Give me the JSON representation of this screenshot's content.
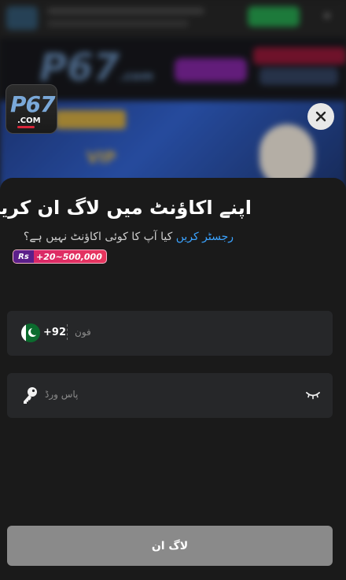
{
  "background": {
    "brand_logo": "P67",
    "brand_suffix": ".com"
  },
  "app_icon": {
    "logo_text": "P67",
    "domain_text": ".COM"
  },
  "modal": {
    "title": "اپنے اکاؤنٹ میں لاگ ان کریں",
    "subtitle_text": "کیا آپ کا کوئی اکاؤنٹ نہیں ہے؟",
    "register_link": "رجسٹر کریں",
    "bonus": {
      "currency": "Rs",
      "amount": "+20~500,000"
    },
    "phone": {
      "country_code": "+92",
      "placeholder": "فون",
      "flag_icon": "pakistan-flag-icon"
    },
    "password": {
      "placeholder": "پاس ورڈ",
      "key_icon": "key-icon",
      "visibility_icon": "eye-closed-icon"
    },
    "login_button": "لاگ ان"
  },
  "colors": {
    "sheet_bg": "#1a1a1a",
    "field_bg": "#262729",
    "link": "#3ba3ff",
    "button_disabled": "#8a8a8a"
  }
}
